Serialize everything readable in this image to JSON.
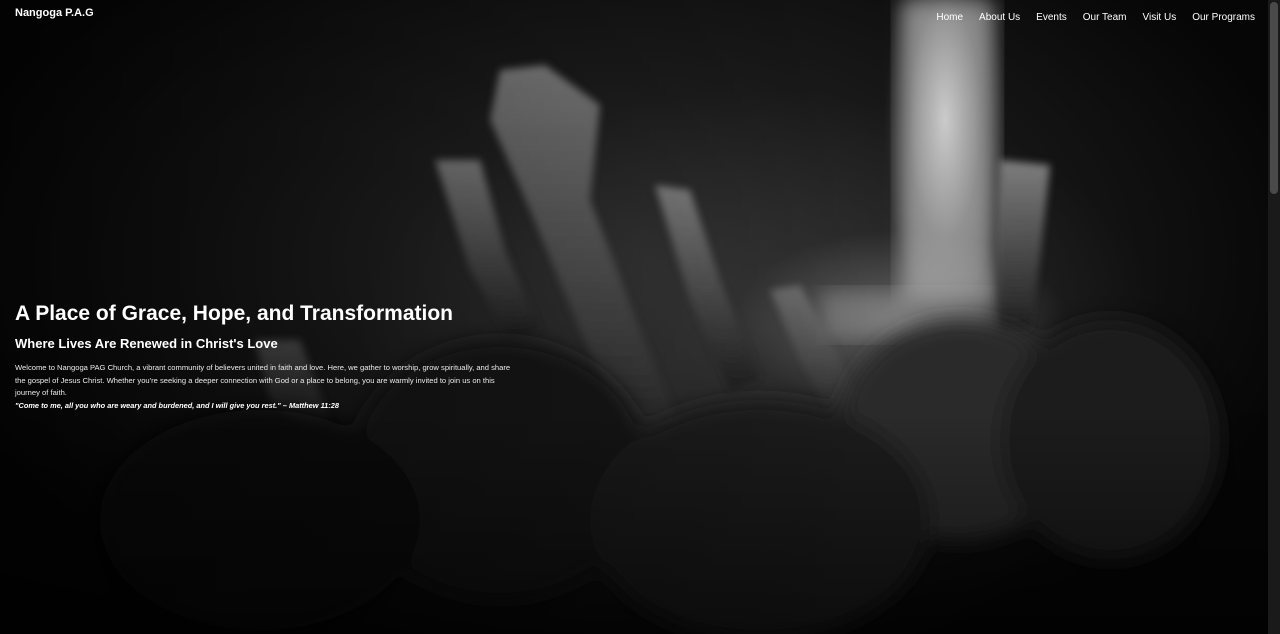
{
  "nav": {
    "brand": "Nangoga P.A.G",
    "links": [
      "Home",
      "About Us",
      "Events",
      "Our Team",
      "Visit Us",
      "Our Programs"
    ]
  },
  "hero": {
    "background_image": "black-and-white-worship-raised-hands",
    "title": "A Place of Grace, Hope, and Transformation",
    "subtitle": "Where Lives Are Renewed in Christ's Love",
    "text": "Welcome to Nangoga PAG Church, a vibrant community of believers united in faith and love. Here, we gather to worship, grow spiritually, and share the gospel of Jesus Christ. Whether you're seeking a deeper connection with God or a place to belong, you are warmly invited to join us on this journey of faith.",
    "verse": "\"Come to me, all you who are weary and burdened, and I will give you rest.\" – Matthew 11:28"
  },
  "colors": {
    "text": "#ffffff",
    "background": "#0b0b0b"
  }
}
